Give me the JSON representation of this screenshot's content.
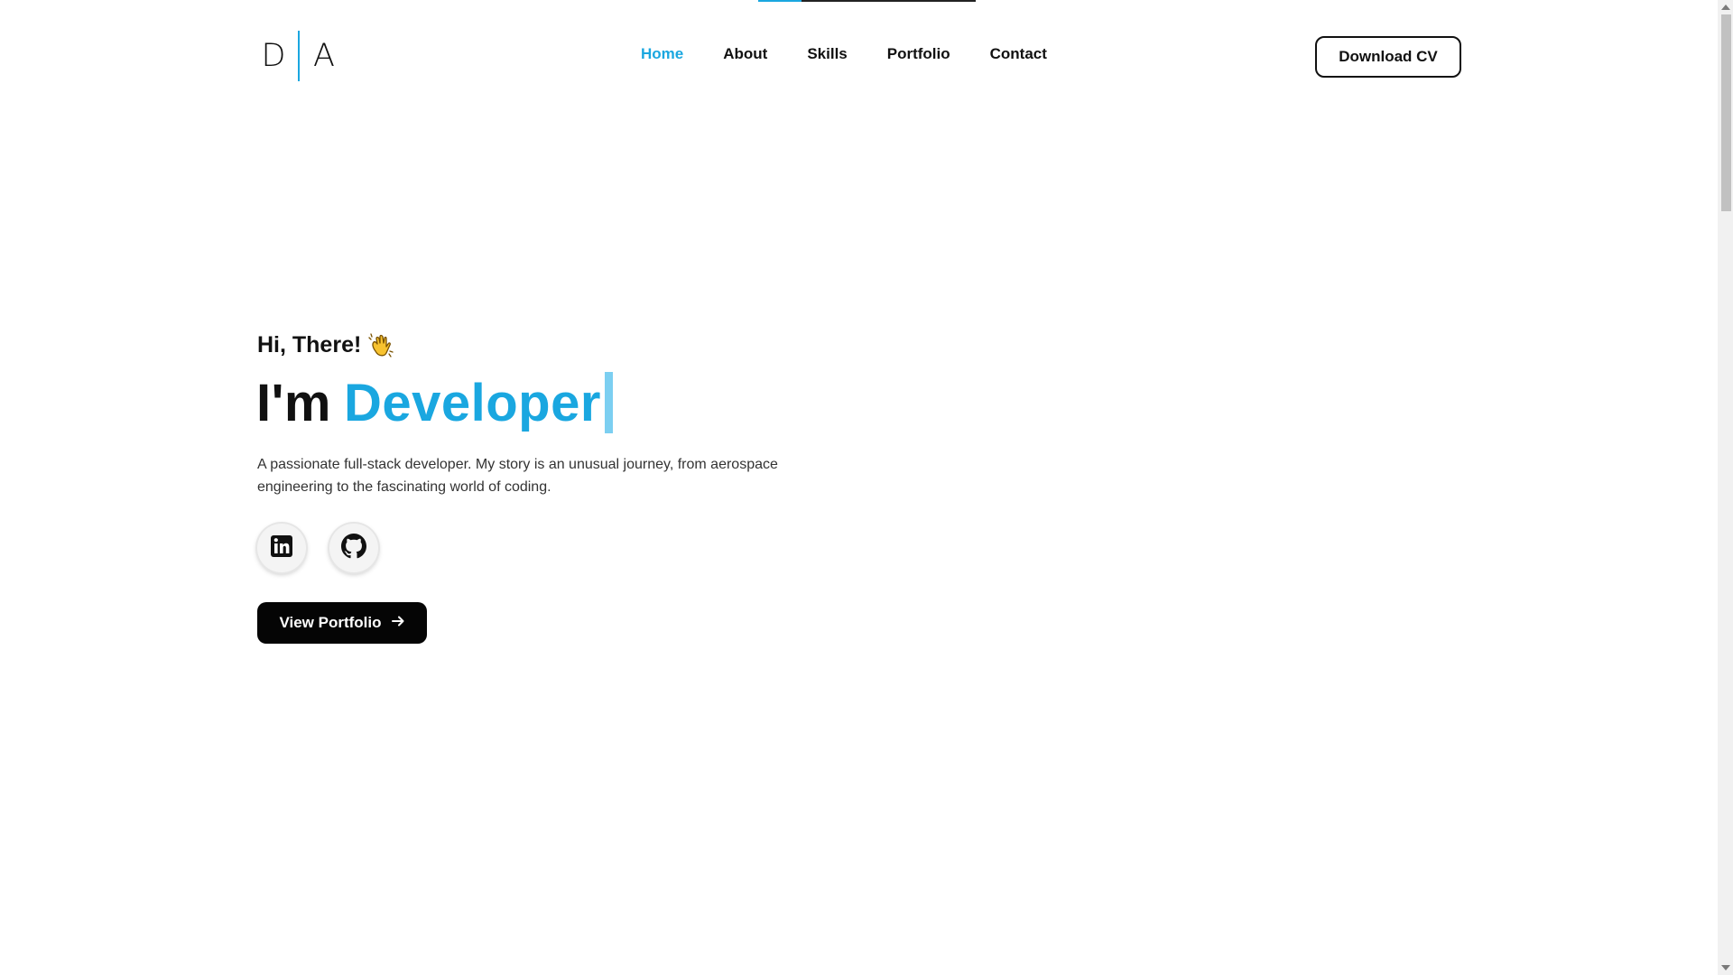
{
  "header": {
    "logo_left": "D",
    "logo_right": "A",
    "nav": [
      {
        "label": "Home",
        "active": true
      },
      {
        "label": "About",
        "active": false
      },
      {
        "label": "Skills",
        "active": false
      },
      {
        "label": "Portfolio",
        "active": false
      },
      {
        "label": "Contact",
        "active": false
      }
    ],
    "cv_button": "Download CV"
  },
  "hero": {
    "greeting": "Hi, There!",
    "headline_prefix": "I'm",
    "headline_role": "Developer",
    "description": "A passionate full-stack developer. My story is an unusual journey, from aerospace engineering to the fascinating world of coding.",
    "social": [
      {
        "icon": "linkedin-icon"
      },
      {
        "icon": "github-icon"
      }
    ],
    "cta": "View Portfolio"
  },
  "colors": {
    "accent": "#1aa7e0",
    "text": "#111111",
    "button_bg": "#050505"
  }
}
